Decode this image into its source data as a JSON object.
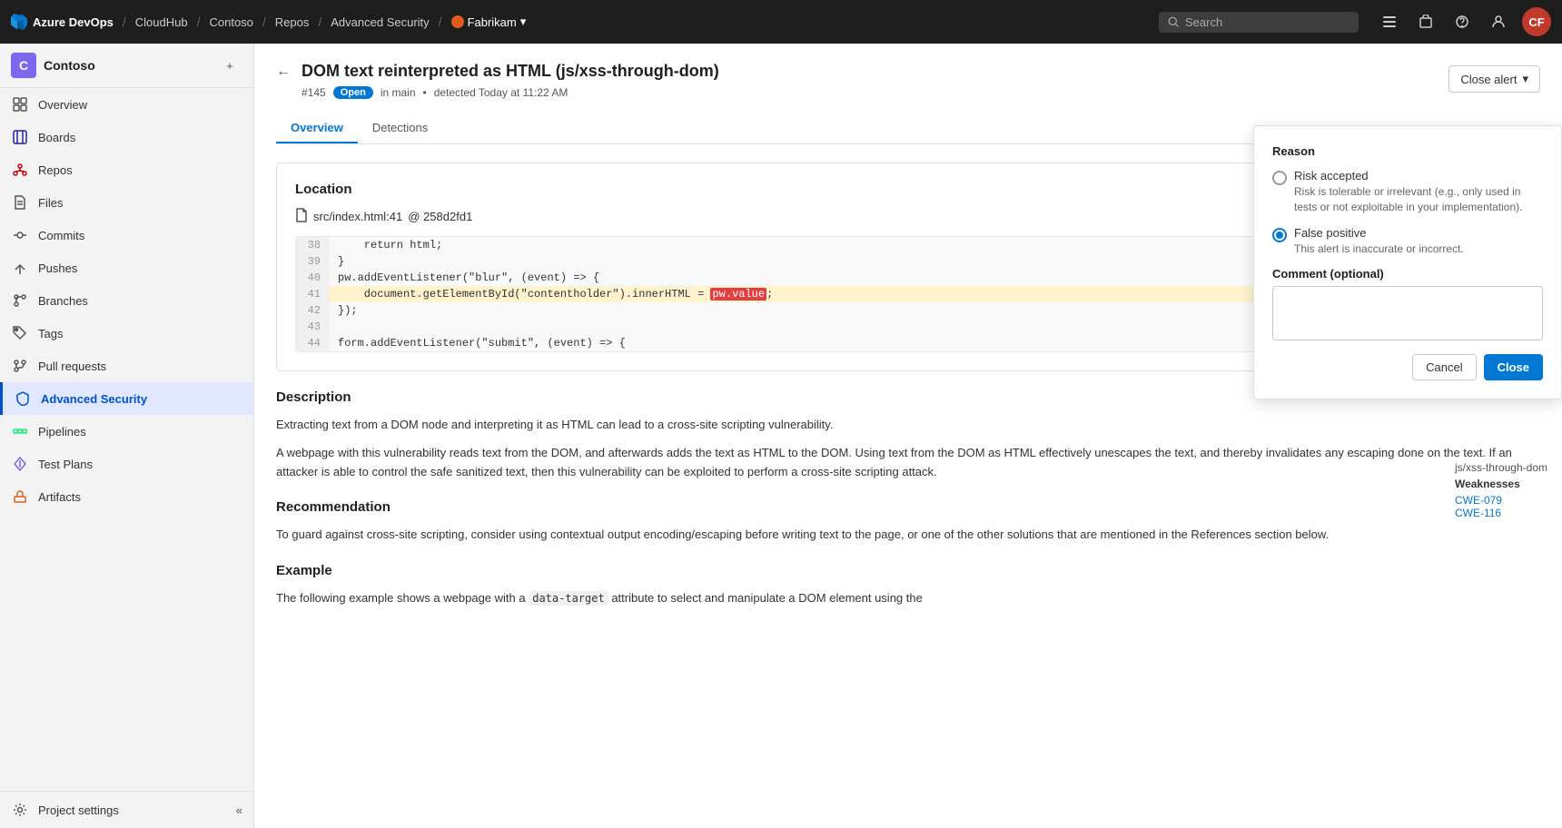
{
  "topnav": {
    "logo_text": "Azure DevOps",
    "crumb1": "CloudHub",
    "crumb2": "Contoso",
    "crumb3": "Repos",
    "crumb4": "Advanced Security",
    "brand": "Fabrikam",
    "search_placeholder": "Search",
    "avatar_initials": "CF"
  },
  "sidebar": {
    "project_initial": "C",
    "project_name": "Contoso",
    "items": [
      {
        "id": "overview",
        "label": "Overview",
        "icon": "overview"
      },
      {
        "id": "boards",
        "label": "Boards",
        "icon": "boards"
      },
      {
        "id": "repos",
        "label": "Repos",
        "icon": "repos"
      },
      {
        "id": "files",
        "label": "Files",
        "icon": "files"
      },
      {
        "id": "commits",
        "label": "Commits",
        "icon": "commits"
      },
      {
        "id": "pushes",
        "label": "Pushes",
        "icon": "pushes"
      },
      {
        "id": "branches",
        "label": "Branches",
        "icon": "branches"
      },
      {
        "id": "tags",
        "label": "Tags",
        "icon": "tags"
      },
      {
        "id": "pull-requests",
        "label": "Pull requests",
        "icon": "pull-requests"
      },
      {
        "id": "advanced-security",
        "label": "Advanced Security",
        "icon": "advanced-security",
        "active": true
      },
      {
        "id": "pipelines",
        "label": "Pipelines",
        "icon": "pipelines"
      },
      {
        "id": "test-plans",
        "label": "Test Plans",
        "icon": "test-plans"
      },
      {
        "id": "artifacts",
        "label": "Artifacts",
        "icon": "artifacts"
      }
    ],
    "project_settings": "Project settings",
    "collapse_label": "Collapse"
  },
  "page": {
    "back_button": "←",
    "title": "DOM text reinterpreted as HTML (js/xss-through-dom)",
    "alert_number": "#145",
    "status": "Open",
    "location": "in main",
    "detected": "detected Today at 11:22 AM",
    "close_alert_label": "Close alert",
    "tabs": [
      {
        "id": "overview",
        "label": "Overview",
        "active": true
      },
      {
        "id": "detections",
        "label": "Detections",
        "active": false
      }
    ],
    "location_section": "Location",
    "file_path": "src/index.html:41",
    "at_commit": "@ 258d2fd1",
    "code_lines": [
      {
        "num": "38",
        "content": "    return html;",
        "highlighted": false
      },
      {
        "num": "39",
        "content": "}",
        "highlighted": false
      },
      {
        "num": "40",
        "content": "pw.addEventListener(\"blur\", (event) => {",
        "highlighted": false
      },
      {
        "num": "41",
        "content_before": "    document.getElementById(\"contentholder\").innerHTML = ",
        "highlight": "pw.value",
        "content_after": ";",
        "highlighted": true
      },
      {
        "num": "42",
        "content": "});",
        "highlighted": false
      },
      {
        "num": "43",
        "content": "",
        "highlighted": false
      },
      {
        "num": "44",
        "content": "form.addEventListener(\"submit\", (event) => {",
        "highlighted": false
      }
    ],
    "description_title": "Description",
    "desc_para1": "Extracting text from a DOM node and interpreting it as HTML can lead to a cross-site scripting vulnerability.",
    "desc_para2": "A webpage with this vulnerability reads text from the DOM, and afterwards adds the text as HTML to the DOM. Using text from the DOM as HTML effectively unescapes the text, and thereby invalidates any escaping done on the text. If an attacker is able to control the safe sanitized text, then this vulnerability can be exploited to perform a cross-site scripting attack.",
    "recommendation_title": "Recommendation",
    "recommendation_text": "To guard against cross-site scripting, consider using contextual output encoding/escaping before writing text to the page, or one of the other solutions that are mentioned in the References section below.",
    "example_title": "Example",
    "example_text": "The following example shows a webpage with a data-target attribute to select and manipulate a DOM element using the",
    "side_ref": "js/xss-through-dom",
    "weaknesses_label": "Weaknesses",
    "cwe1": "CWE-079",
    "cwe2": "CWE-116"
  },
  "close_alert_panel": {
    "title": "Reason",
    "option1_label": "Risk accepted",
    "option1_desc": "Risk is tolerable or irrelevant (e.g., only used in tests or not exploitable in your implementation).",
    "option2_label": "False positive",
    "option2_desc": "This alert is inaccurate or incorrect.",
    "option2_selected": true,
    "comment_label": "Comment (optional)",
    "comment_placeholder": "",
    "cancel_label": "Cancel",
    "close_label": "Close"
  }
}
